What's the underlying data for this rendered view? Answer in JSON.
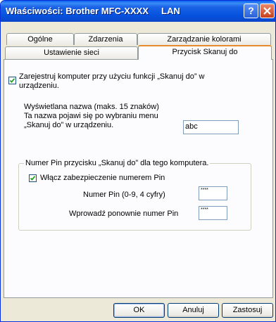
{
  "window": {
    "title": "Właściwości: Brother MFC-XXXX     LAN"
  },
  "tabs": {
    "row1": [
      "Ogólne",
      "Zdarzenia",
      "Zarządzanie kolorami"
    ],
    "row2": [
      "Ustawienie sieci",
      "Przycisk Skanuj do"
    ],
    "active": "Przycisk Skanuj do"
  },
  "register": {
    "checked": true,
    "label_line1": "Zarejestruj komputer przy użyciu funkcji „Skanuj do” w",
    "label_line2": "urządzeniu."
  },
  "display_name": {
    "desc_line1": "Wyświetlana nazwa (maks. 15 znaków)",
    "desc_line2": "Ta nazwa pojawi się po wybraniu menu",
    "desc_line3": "„Skanuj do” w urządzeniu.",
    "value": "abc"
  },
  "pin_group": {
    "title": "Numer Pin przycisku „Skanuj do” dla tego komputera.",
    "enable_checked": true,
    "enable_label": "Włącz zabezpieczenie numerem Pin",
    "pin_label": "Numer Pin (0-9, 4 cyfry)",
    "pin_value": "****",
    "reenter_label": "Wprowadź ponownie numer Pin",
    "reenter_value": "****"
  },
  "buttons": {
    "ok": "OK",
    "cancel": "Anuluj",
    "apply": "Zastosuj"
  },
  "colors": {
    "titlebar": "#0a5ff0",
    "dialog_bg": "#ece9d8",
    "active_tab_accent": "#e68b2c"
  }
}
